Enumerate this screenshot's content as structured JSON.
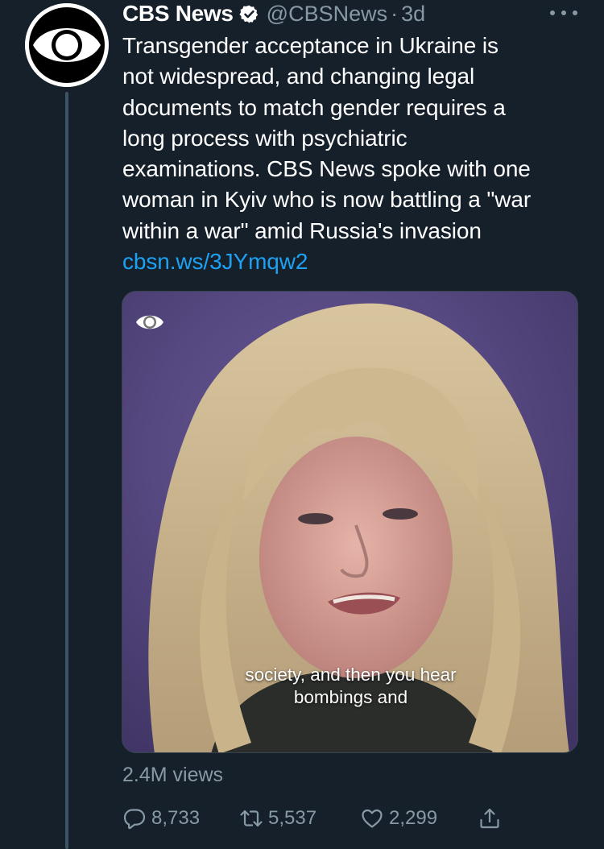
{
  "tweet": {
    "display_name": "CBS News",
    "handle": "@CBSNews",
    "separator": "·",
    "timestamp": "3d",
    "verified": true,
    "body_lines": [
      "Transgender acceptance in Ukraine is",
      "not widespread, and changing legal",
      "documents to match gender requires a",
      "long process with psychiatric",
      "examinations. CBS News spoke with one",
      "woman in Kyiv who is now battling a \"war",
      "within a war\" amid Russia's invasion"
    ],
    "link_text": "cbsn.ws/3JYmqw2",
    "media": {
      "caption_lines": [
        "society, and then you hear",
        "bombings and"
      ],
      "logo": "cbs-eye-logo"
    },
    "views": "2.4M views",
    "actions": {
      "reply_count": "8,733",
      "retweet_count": "5,537",
      "like_count": "2,299"
    }
  },
  "icons": {
    "avatar": "cbs-eye-logo",
    "verified": "verified-badge-icon",
    "more": "more-options-icon",
    "reply": "reply-icon",
    "retweet": "retweet-icon",
    "like": "heart-icon",
    "share": "share-icon"
  },
  "colors": {
    "background": "#15202b",
    "secondary_text": "#8899a6",
    "link": "#1da1f2",
    "thread_line": "#3d5466"
  }
}
